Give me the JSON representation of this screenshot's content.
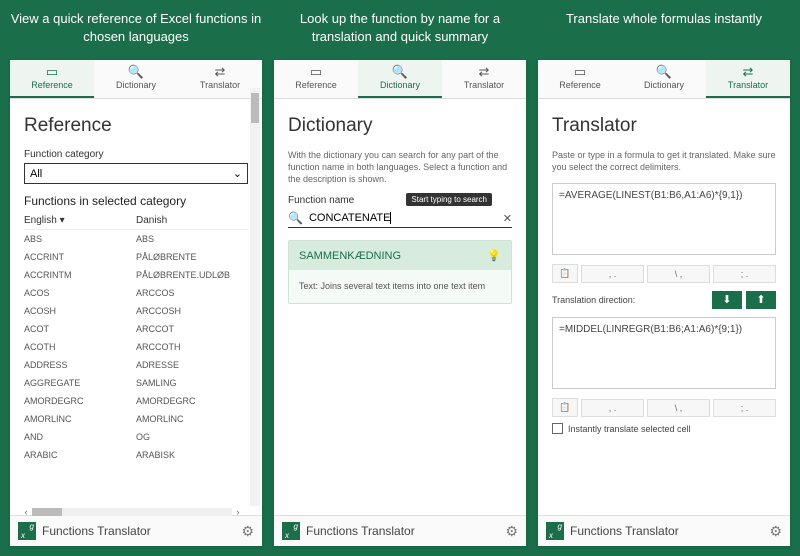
{
  "captions": {
    "p1": "View a quick reference of Excel functions in chosen languages",
    "p2": "Look up the function by name for a translation and quick summary",
    "p3": "Translate whole formulas instantly"
  },
  "tabs": {
    "reference": "Reference",
    "dictionary": "Dictionary",
    "translator": "Translator"
  },
  "footer": {
    "title": "Functions Translator"
  },
  "p1": {
    "title": "Reference",
    "catLabel": "Function category",
    "catValue": "All",
    "subhead": "Functions in selected category",
    "cols": {
      "a": "English",
      "b": "Danish"
    },
    "rows": [
      {
        "a": "ABS",
        "b": "ABS"
      },
      {
        "a": "ACCRINT",
        "b": "PÅLØBRENTE"
      },
      {
        "a": "ACCRINTM",
        "b": "PÅLØBRENTE.UDLØB"
      },
      {
        "a": "ACOS",
        "b": "ARCCOS"
      },
      {
        "a": "ACOSH",
        "b": "ARCCOSH"
      },
      {
        "a": "ACOT",
        "b": "ARCCOT"
      },
      {
        "a": "ACOTH",
        "b": "ARCCOTH"
      },
      {
        "a": "ADDRESS",
        "b": "ADRESSE"
      },
      {
        "a": "AGGREGATE",
        "b": "SAMLING"
      },
      {
        "a": "AMORDEGRC",
        "b": "AMORDEGRC"
      },
      {
        "a": "AMORLINC",
        "b": "AMORLINC"
      },
      {
        "a": "AND",
        "b": "OG"
      },
      {
        "a": "ARABIC",
        "b": "ARABISK"
      }
    ]
  },
  "p2": {
    "title": "Dictionary",
    "desc": "With the dictionary you can search for any part of the function name in both languages. Select a function and the description is shown.",
    "fnLabel": "Function name",
    "tooltip": "Start typing to search",
    "searchValue": "CONCATENATE",
    "result": {
      "name": "SAMMENKÆDNING",
      "desc": "Text: Joins several text items into one text item"
    }
  },
  "p3": {
    "title": "Translator",
    "desc": "Paste or type in a formula to get it translated. Make sure you select the correct delimiters.",
    "inputFormula": "=AVERAGE(LINEST(B1:B6,A1:A6)*{9,1})",
    "outputFormula": "=MIDDEL(LINREGR(B1:B6;A1:A6)*{9;1})",
    "dirLabel": "Translation direction:",
    "delims": {
      "d1": ", .",
      "d2": "\\ ,",
      "d3": "; ."
    },
    "chk": "Instantly translate selected cell"
  }
}
